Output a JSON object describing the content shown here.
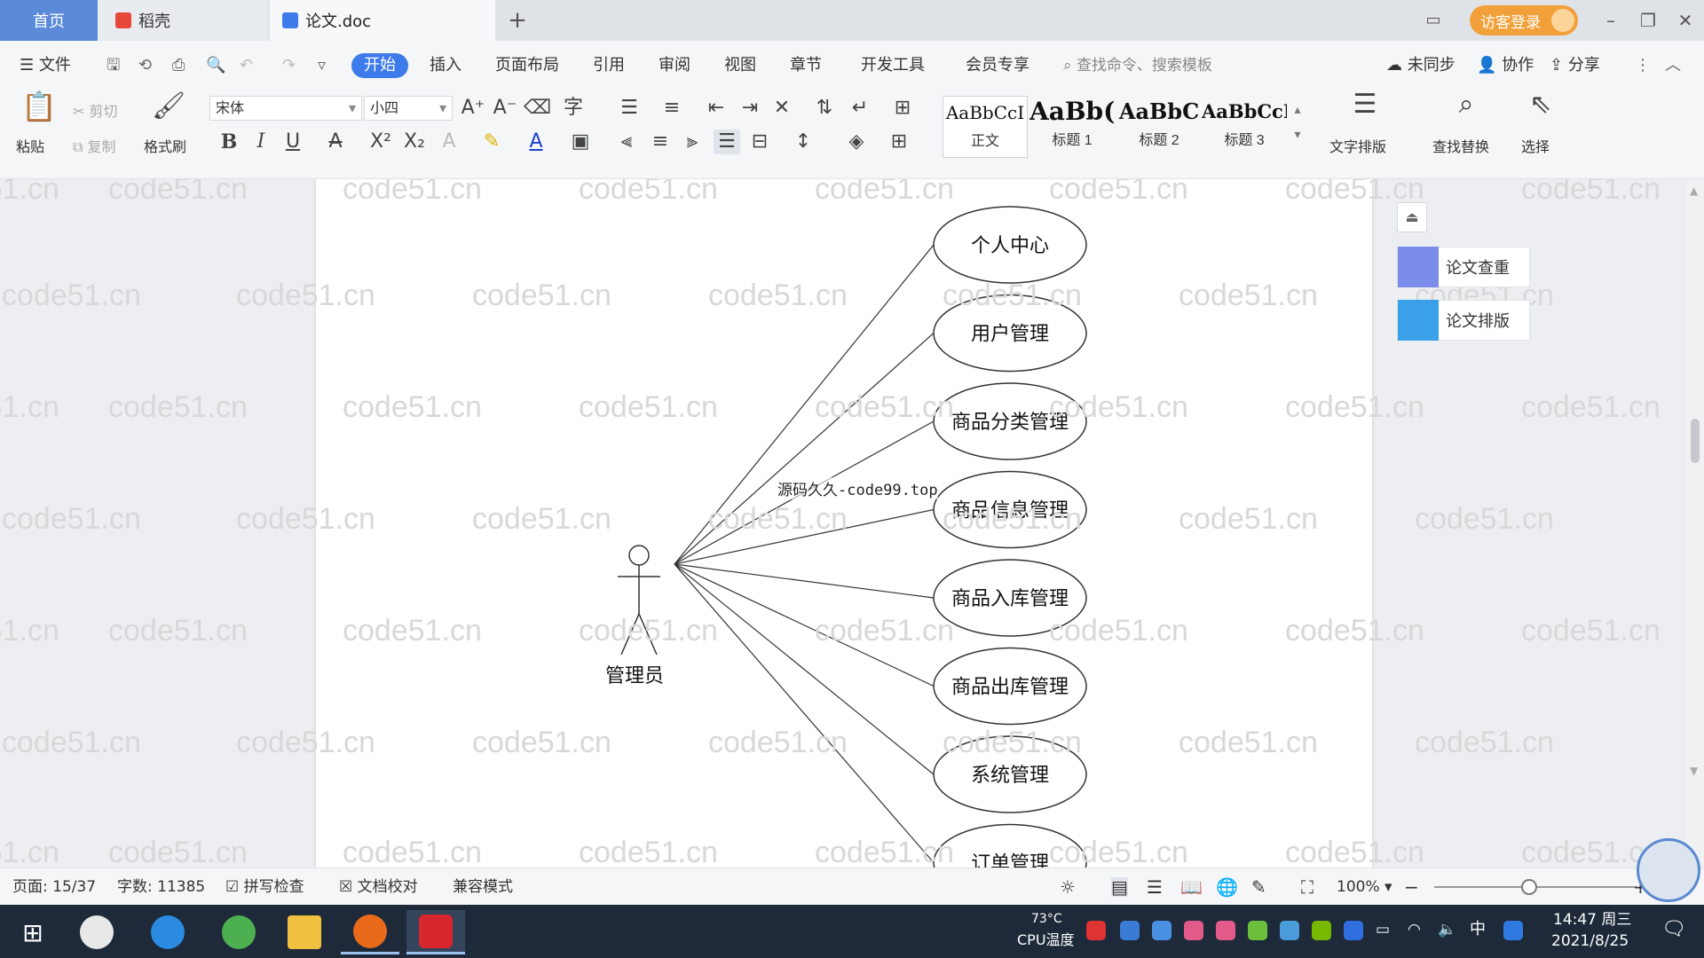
{
  "tabs": {
    "home": "首页",
    "daoke": "稻壳",
    "doc": "论文.doc",
    "new_tab": "+"
  },
  "titlebar": {
    "guest_login": "访客登录"
  },
  "menu": {
    "file": "文件",
    "items": [
      "开始",
      "插入",
      "页面布局",
      "引用",
      "审阅",
      "视图",
      "章节",
      "开发工具",
      "会员专享"
    ],
    "search_placeholder": "查找命令、搜索模板",
    "unsynced": "未同步",
    "collab": "协作",
    "share": "分享"
  },
  "ribbon": {
    "paste": "粘贴",
    "cut": "剪切",
    "copy": "复制",
    "format_painter": "格式刷",
    "font_name": "宋体",
    "font_size": "小四",
    "styles": [
      {
        "sample": "AaBbCcI",
        "name": "正文"
      },
      {
        "sample": "AaBb(",
        "name": "标题 1"
      },
      {
        "sample": "AaBbC",
        "name": "标题 2"
      },
      {
        "sample": "AaBbCcI",
        "name": "标题 3"
      }
    ],
    "text_layout": "文字排版",
    "find_replace": "查找替换",
    "select": "选择"
  },
  "diagram": {
    "actor": "管理员",
    "use_cases": [
      "个人中心",
      "用户管理",
      "商品分类管理",
      "商品信息管理",
      "商品入库管理",
      "商品出库管理",
      "系统管理",
      "订单管理"
    ],
    "overlay_text": "源码久久-code99.top"
  },
  "watermark": "code51.cn",
  "side_panel": {
    "check": "论文查重",
    "layout": "论文排版"
  },
  "status": {
    "page": "页面: 15/37",
    "words": "字数: 11385",
    "spell": "拼写检查",
    "proof": "文档校对",
    "compat": "兼容模式",
    "zoom": "100%"
  },
  "taskbar": {
    "cpu_temp": "73°C",
    "cpu_label": "CPU温度",
    "ime": "中",
    "time": "14:47 周三",
    "date": "2021/8/25"
  }
}
